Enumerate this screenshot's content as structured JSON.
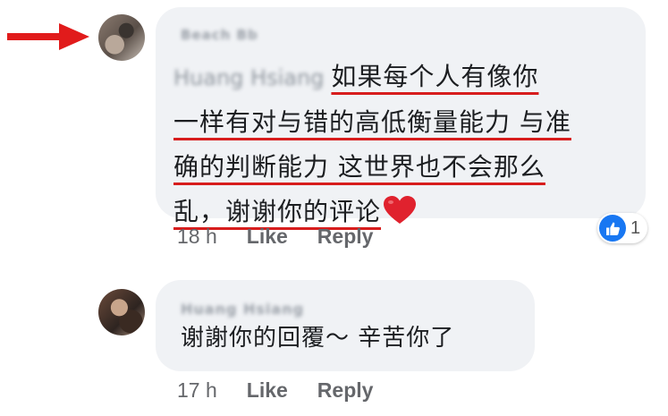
{
  "colors": {
    "bubble": "#f0f2f5",
    "text": "#1c1e21",
    "meta": "#65676b",
    "annotation_red": "#d71d1d",
    "like_blue": "#1877f2"
  },
  "comment": {
    "author": "Beach Bb",
    "mention": "Huang Hsiang",
    "lines": [
      "如果每个人有像你",
      "一样有对与错的高低衡量能力 与准",
      "确的判断能力 这世界也不会那么",
      "乱，谢谢你的评论"
    ],
    "emoji": "heart-emoji",
    "reaction_icon": "like-icon",
    "reaction_count": "1",
    "time": "18 h",
    "like_label": "Like",
    "reply_label": "Reply"
  },
  "reply": {
    "author": "Huang Hsiang",
    "text": "谢謝你的回覆～  辛苦你了",
    "time": "17 h",
    "like_label": "Like",
    "reply_label": "Reply"
  }
}
